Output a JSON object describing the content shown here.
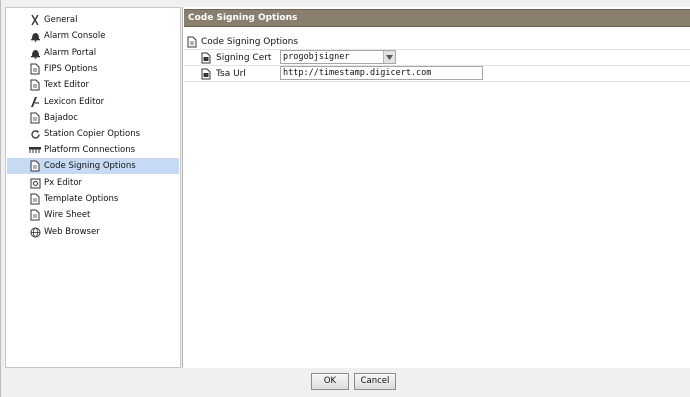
{
  "sidebar": {
    "items": [
      {
        "label": "General",
        "icon": "general-icon"
      },
      {
        "label": "Alarm Console",
        "icon": "bell-icon"
      },
      {
        "label": "Alarm Portal",
        "icon": "bell-icon"
      },
      {
        "label": "FIPS Options",
        "icon": "document-icon"
      },
      {
        "label": "Text Editor",
        "icon": "document-icon"
      },
      {
        "label": "Lexicon Editor",
        "icon": "lexicon-icon"
      },
      {
        "label": "Bajadoc",
        "icon": "document-icon"
      },
      {
        "label": "Station Copier Options",
        "icon": "refresh-icon"
      },
      {
        "label": "Platform Connections",
        "icon": "connector-icon"
      },
      {
        "label": "Code Signing Options",
        "icon": "document-icon"
      },
      {
        "label": "Px Editor",
        "icon": "px-icon"
      },
      {
        "label": "Template Options",
        "icon": "document-icon"
      },
      {
        "label": "Wire Sheet",
        "icon": "document-icon"
      },
      {
        "label": "Web Browser",
        "icon": "globe-icon"
      }
    ],
    "selected": "Code Signing Options"
  },
  "main": {
    "title": "Code Signing Options",
    "section_label": "Code Signing Options",
    "properties": [
      {
        "label": "Signing Cert",
        "value": "progobjsigner"
      },
      {
        "label": "Tsa Url",
        "value": "http://timestamp.digicert.com"
      }
    ]
  },
  "buttons": {
    "ok": "OK",
    "cancel": "Cancel"
  },
  "colors": {
    "title_bar": "#8a7f6e",
    "selected_row": "#c6daf4"
  }
}
